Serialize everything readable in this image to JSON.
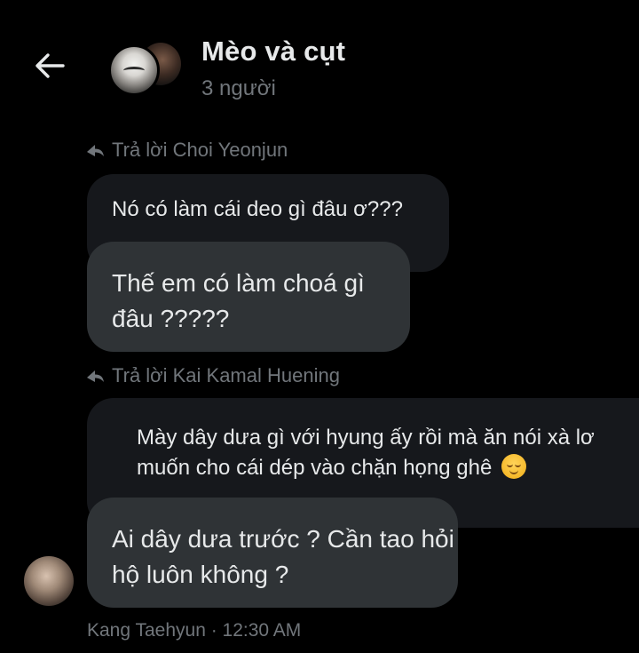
{
  "header": {
    "title": "Mèo và cụt",
    "subtitle": "3 người",
    "icons": {
      "back": "arrow-left-icon"
    }
  },
  "messages": [
    {
      "reply_to": "Trả lời Choi Yeonjun",
      "quoted_text": "Nó có làm cái deo gì đâu ơ???",
      "text": "Thế em có làm choá gì đâu ?????"
    },
    {
      "reply_to": "Trả lời Kai Kamal Huening",
      "quoted_text": "Mày dây dưa gì với hyung ấy rồi mà ăn nói xà lơ muốn cho cái dép vào chặn họng ghê",
      "quoted_emoji": "smiling-face-emoji",
      "text": "Ai dây dưa trước ? Cần tao hỏi hộ luôn không ?"
    }
  ],
  "meta": "Kang Taehyun · 12:30 AM",
  "colors": {
    "background": "#000000",
    "bubble": "#2f3336",
    "quoted_bubble": "#16181c",
    "primary_text": "#e7e9ea",
    "secondary_text": "#71767b"
  }
}
